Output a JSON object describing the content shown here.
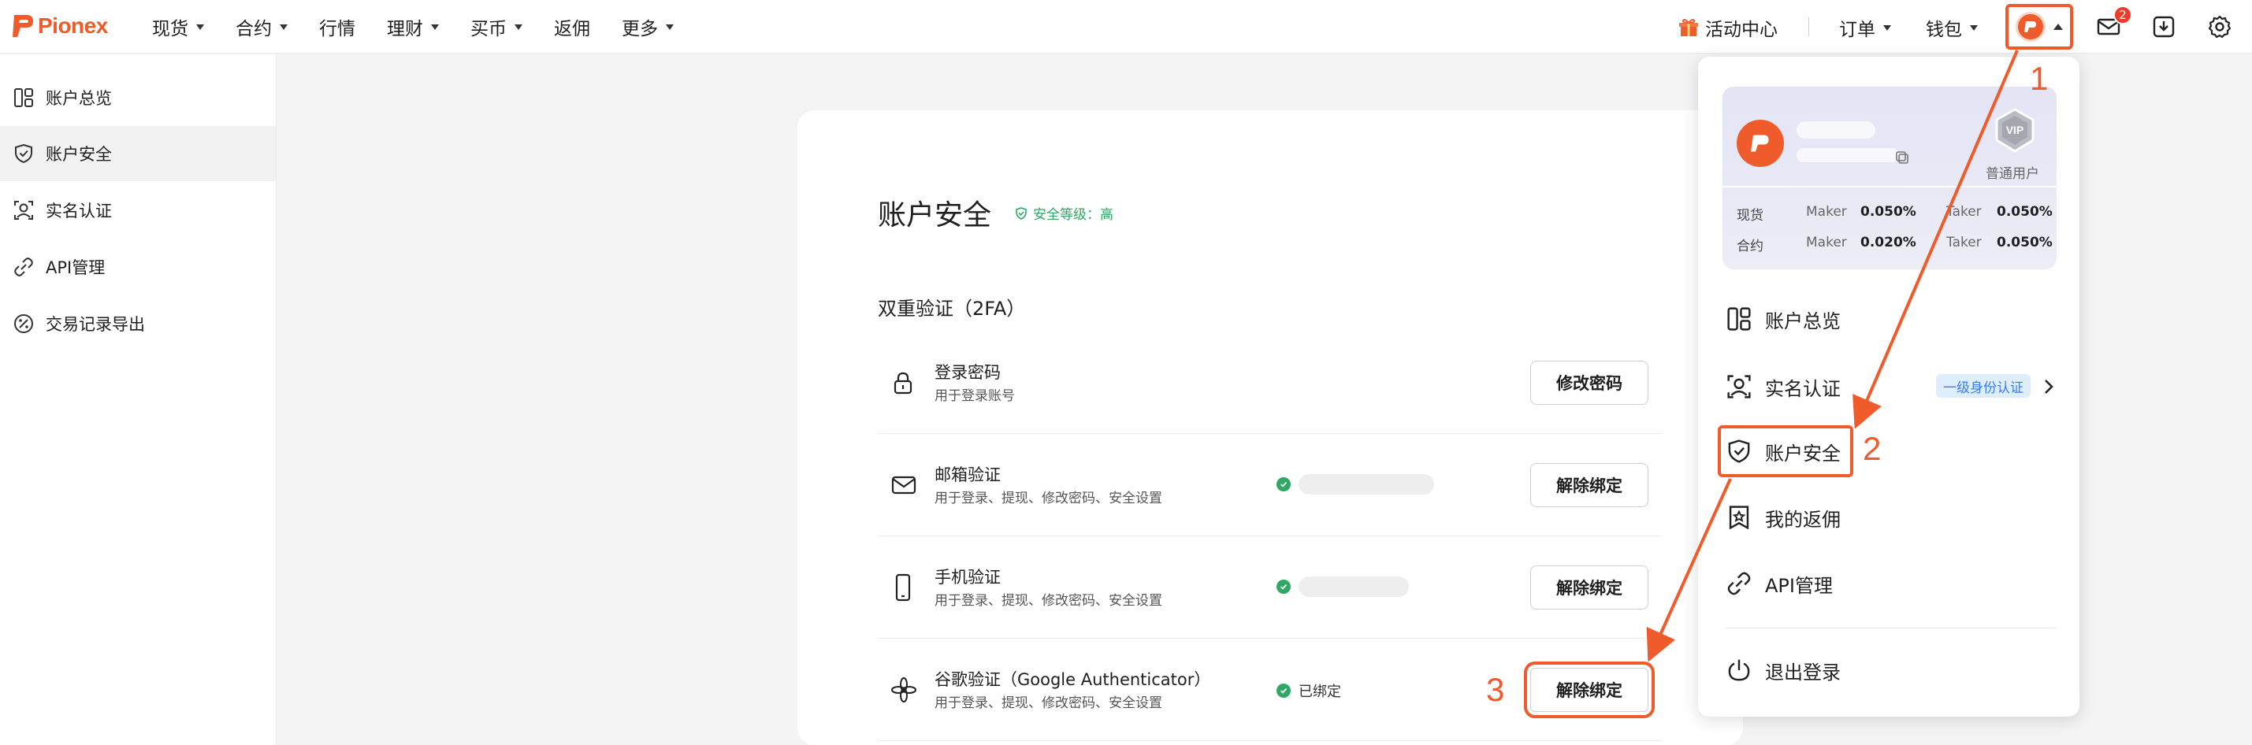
{
  "brand": {
    "name": "Pionex",
    "color": "#ef5b2a"
  },
  "nav": {
    "items": [
      {
        "label": "现货",
        "dropdown": true
      },
      {
        "label": "合约",
        "dropdown": true
      },
      {
        "label": "行情",
        "dropdown": false
      },
      {
        "label": "理财",
        "dropdown": true
      },
      {
        "label": "买币",
        "dropdown": true
      },
      {
        "label": "返佣",
        "dropdown": false
      },
      {
        "label": "更多",
        "dropdown": true
      }
    ],
    "activity_center": "活动中心",
    "orders": "订单",
    "wallet": "钱包",
    "mail_badge": "2"
  },
  "sidebar": {
    "items": [
      {
        "label": "账户总览",
        "icon": "dashboard-icon"
      },
      {
        "label": "账户安全",
        "icon": "shield-icon",
        "active": true
      },
      {
        "label": "实名认证",
        "icon": "user-scan-icon"
      },
      {
        "label": "API管理",
        "icon": "api-link-icon"
      },
      {
        "label": "交易记录导出",
        "icon": "percent-icon"
      }
    ]
  },
  "main": {
    "title": "账户安全",
    "security_level": "安全等级：高",
    "section_title": "双重验证（2FA）",
    "rows": [
      {
        "title": "登录密码",
        "subtitle": "用于登录账号",
        "button": "修改密码",
        "icon": "lock-icon"
      },
      {
        "title": "邮箱验证",
        "subtitle": "用于登录、提现、修改密码、安全设置",
        "button": "解除绑定",
        "icon": "mail-icon"
      },
      {
        "title": "手机验证",
        "subtitle": "用于登录、提现、修改密码、安全设置",
        "button": "解除绑定",
        "icon": "phone-icon"
      },
      {
        "title": "谷歌验证（Google Authenticator）",
        "subtitle": "用于登录、提现、修改密码、安全设置",
        "button": "解除绑定",
        "status": "已绑定",
        "icon": "authenticator-icon"
      }
    ]
  },
  "dropdown": {
    "vip": {
      "badge": "VIP",
      "level": "普通用户"
    },
    "fees": [
      {
        "market": "现货",
        "maker_label": "Maker",
        "maker": "0.050%",
        "taker_label": "Taker",
        "taker": "0.050%"
      },
      {
        "market": "合约",
        "maker_label": "Maker",
        "maker": "0.020%",
        "taker_label": "Taker",
        "taker": "0.050%"
      }
    ],
    "menu": [
      {
        "label": "账户总览",
        "icon": "dashboard-icon"
      },
      {
        "label": "实名认证",
        "icon": "user-scan-icon",
        "badge": "一级身份认证"
      },
      {
        "label": "账户安全",
        "icon": "shield-icon"
      },
      {
        "label": "我的返佣",
        "icon": "star-bookmark-icon"
      },
      {
        "label": "API管理",
        "icon": "api-link-icon"
      },
      {
        "label": "退出登录",
        "icon": "power-icon"
      }
    ]
  },
  "annotations": {
    "color": "#ef5b2a",
    "steps": [
      "1",
      "2",
      "3"
    ]
  }
}
